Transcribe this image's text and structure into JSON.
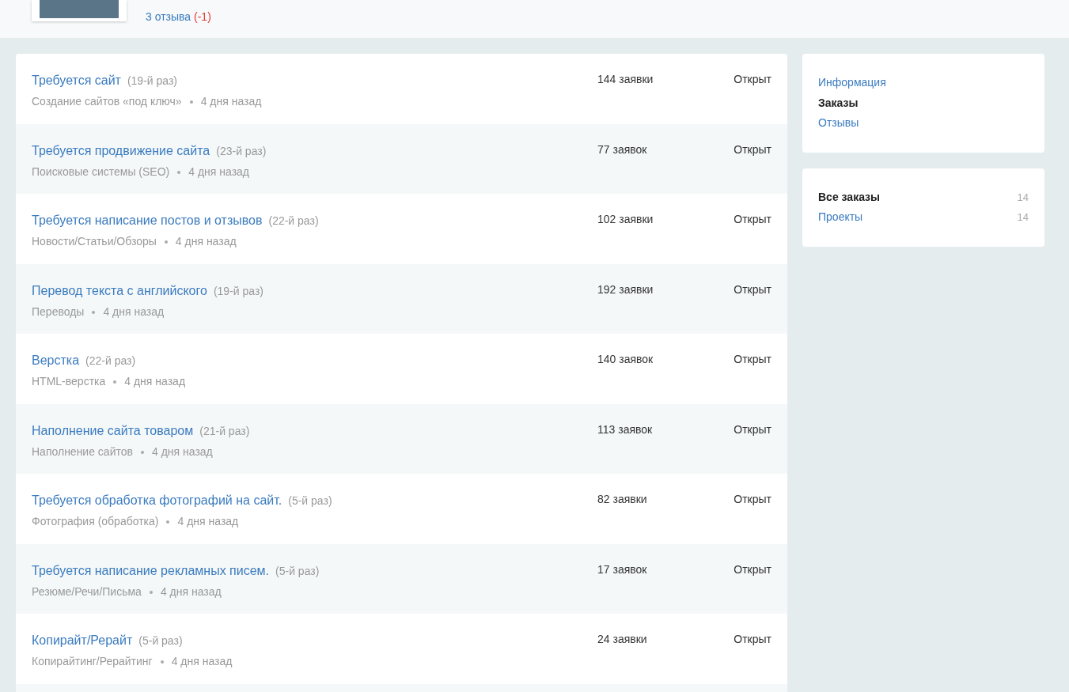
{
  "profile": {
    "reviews_link": "3 отзыва",
    "reviews_delta": "(-1)"
  },
  "orders": [
    {
      "title": "Требуется сайт",
      "repeat": "(19-й раз)",
      "category": "Создание сайтов «под ключ»",
      "age": "4 дня назад",
      "bids": "144 заявки",
      "status": "Открыт"
    },
    {
      "title": "Требуется продвижение сайта",
      "repeat": "(23-й раз)",
      "category": "Поисковые системы (SEO)",
      "age": "4 дня назад",
      "bids": "77 заявок",
      "status": "Открыт"
    },
    {
      "title": "Требуется написание постов и отзывов",
      "repeat": "(22-й раз)",
      "category": "Новости/Статьи/Обзоры",
      "age": "4 дня назад",
      "bids": "102 заявки",
      "status": "Открыт"
    },
    {
      "title": "Перевод текста с английского",
      "repeat": "(19-й раз)",
      "category": "Переводы",
      "age": "4 дня назад",
      "bids": "192 заявки",
      "status": "Открыт"
    },
    {
      "title": "Верстка",
      "repeat": "(22-й раз)",
      "category": "HTML-верстка",
      "age": "4 дня назад",
      "bids": "140 заявок",
      "status": "Открыт"
    },
    {
      "title": "Наполнение сайта товаром",
      "repeat": "(21-й раз)",
      "category": "Наполнение сайтов",
      "age": "4 дня назад",
      "bids": "113 заявок",
      "status": "Открыт"
    },
    {
      "title": "Требуется обработка фотографий на сайт.",
      "repeat": "(5-й раз)",
      "category": "Фотография (обработка)",
      "age": "4 дня назад",
      "bids": "82 заявки",
      "status": "Открыт"
    },
    {
      "title": "Требуется написание рекламных писем.",
      "repeat": "(5-й раз)",
      "category": "Резюме/Речи/Письма",
      "age": "4 дня назад",
      "bids": "17 заявок",
      "status": "Открыт"
    },
    {
      "title": "Копирайт/Рерайт",
      "repeat": "(5-й раз)",
      "category": "Копирайтинг/Рерайтинг",
      "age": "4 дня назад",
      "bids": "24 заявки",
      "status": "Открыт"
    }
  ],
  "profile_nav": [
    {
      "label": "Информация",
      "selected": false
    },
    {
      "label": "Заказы",
      "selected": true
    },
    {
      "label": "Отзывы",
      "selected": false
    }
  ],
  "order_filters": [
    {
      "label": "Все заказы",
      "count": "14",
      "selected": true
    },
    {
      "label": "Проекты",
      "count": "14",
      "selected": false
    }
  ]
}
